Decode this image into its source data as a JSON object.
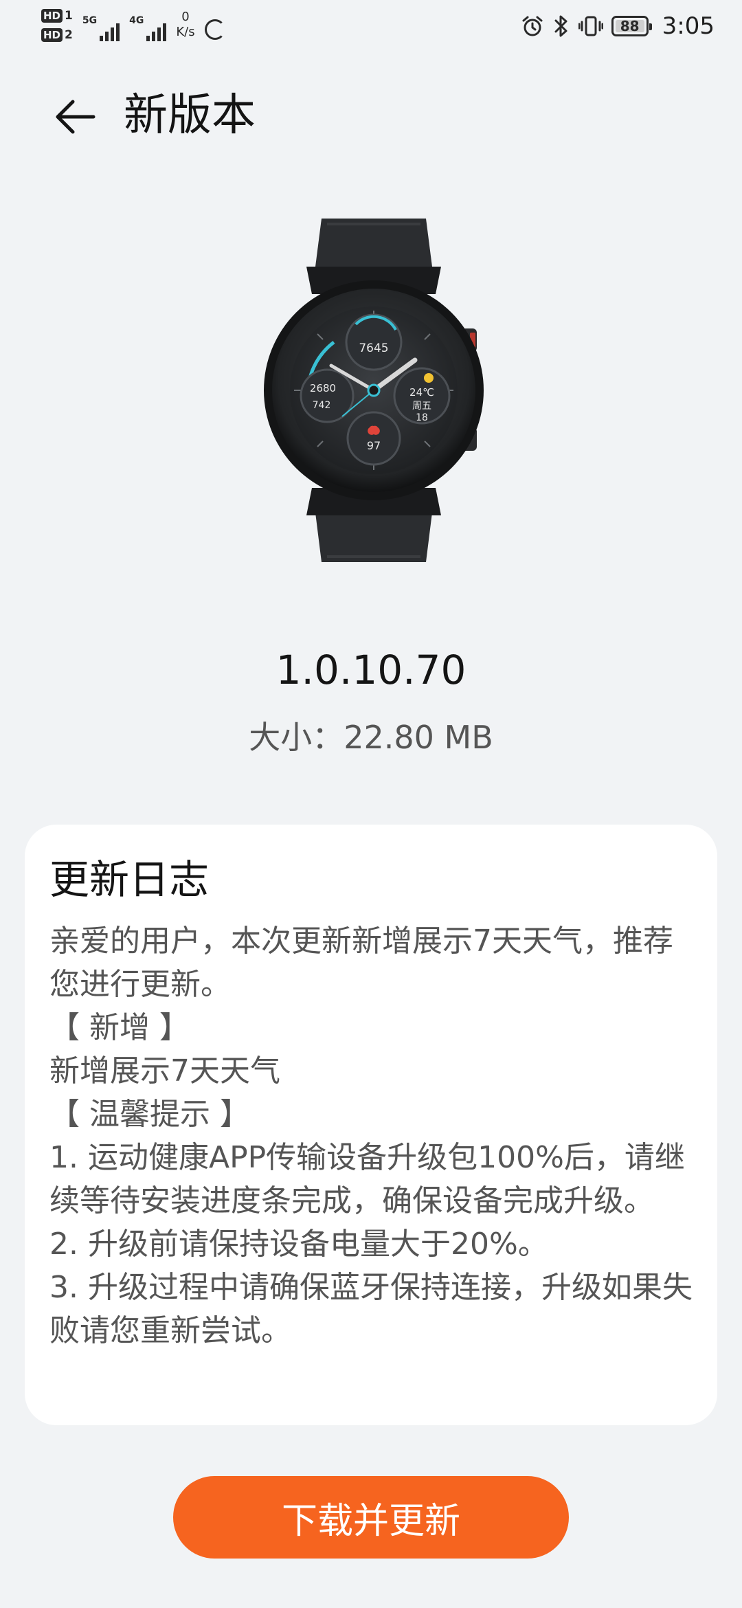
{
  "status_bar": {
    "sim1_label": "HD",
    "sim1_num": "1",
    "sim2_label": "HD",
    "sim2_num": "2",
    "network1": "5G",
    "network2": "4G",
    "speed_value": "0",
    "speed_unit": "K/s",
    "battery_level": "88",
    "time": "3:05",
    "icons": [
      "hd-icon",
      "signal-icon",
      "loading-icon",
      "alarm-icon",
      "bluetooth-icon",
      "vibrate-icon",
      "battery-icon"
    ]
  },
  "header": {
    "title": "新版本",
    "back_icon": "back-arrow-icon"
  },
  "update": {
    "version": "1.0.10.70",
    "size": "大小：22.80 MB"
  },
  "watch_face": {
    "steps": "7645",
    "calories": "2680",
    "distance": "742",
    "temperature": "24℃",
    "weekday": "周五",
    "date": "18",
    "heart_rate": "97"
  },
  "changelog": {
    "title": "更新日志",
    "lines": [
      "亲爱的用户，本次更新新增展示7天天气，推荐您进行更新。",
      "【 新增 】",
      "新增展示7天天气",
      "【 温馨提示 】",
      "1. 运动健康APP传输设备升级包100%后，请继续等待安装进度条完成，确保设备完成升级。",
      "2. 升级前请保持设备电量大于20%。",
      "3. 升级过程中请确保蓝牙保持连接，升级如果失败请您重新尝试。"
    ]
  },
  "actions": {
    "download_label": "下载并更新"
  },
  "colors": {
    "background": "#f1f3f5",
    "card": "#ffffff",
    "accent": "#f6641f",
    "text_primary": "#141414",
    "text_secondary": "#555555"
  }
}
